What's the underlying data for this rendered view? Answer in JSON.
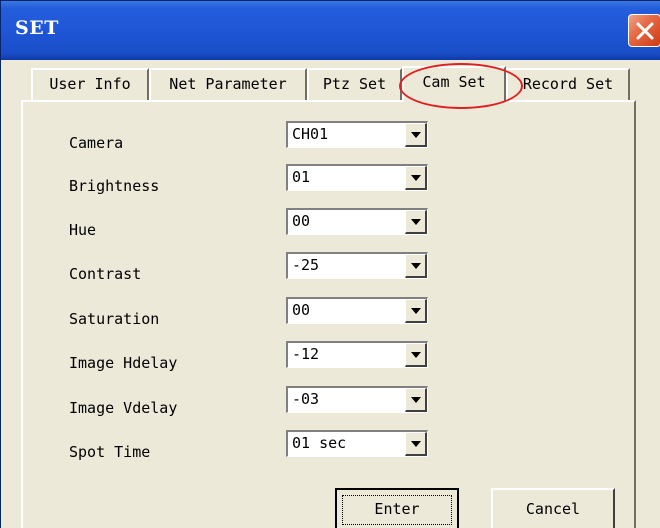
{
  "window": {
    "title": "SET",
    "close_icon": "close-icon"
  },
  "tabs": [
    {
      "label": "User Info"
    },
    {
      "label": "Net Parameter"
    },
    {
      "label": "Ptz Set"
    },
    {
      "label": "Cam Set",
      "active": true
    },
    {
      "label": "Record Set"
    }
  ],
  "highlight_color": "#e02020",
  "cam_set": {
    "rows": [
      {
        "label": "Camera",
        "value": "CH01"
      },
      {
        "label": "Brightness",
        "value": "01"
      },
      {
        "label": "Hue",
        "value": "00"
      },
      {
        "label": "Contrast",
        "value": "-25"
      },
      {
        "label": "Saturation",
        "value": "00"
      },
      {
        "label": "Image Hdelay",
        "value": "-12"
      },
      {
        "label": "Image Vdelay",
        "value": "-03"
      },
      {
        "label": "Spot Time",
        "value": "01 sec"
      }
    ]
  },
  "buttons": {
    "enter": "Enter",
    "cancel": "Cancel"
  },
  "colors": {
    "titlebar": "#1f56d6",
    "face": "#ece9d8",
    "close": "#e56a45"
  }
}
